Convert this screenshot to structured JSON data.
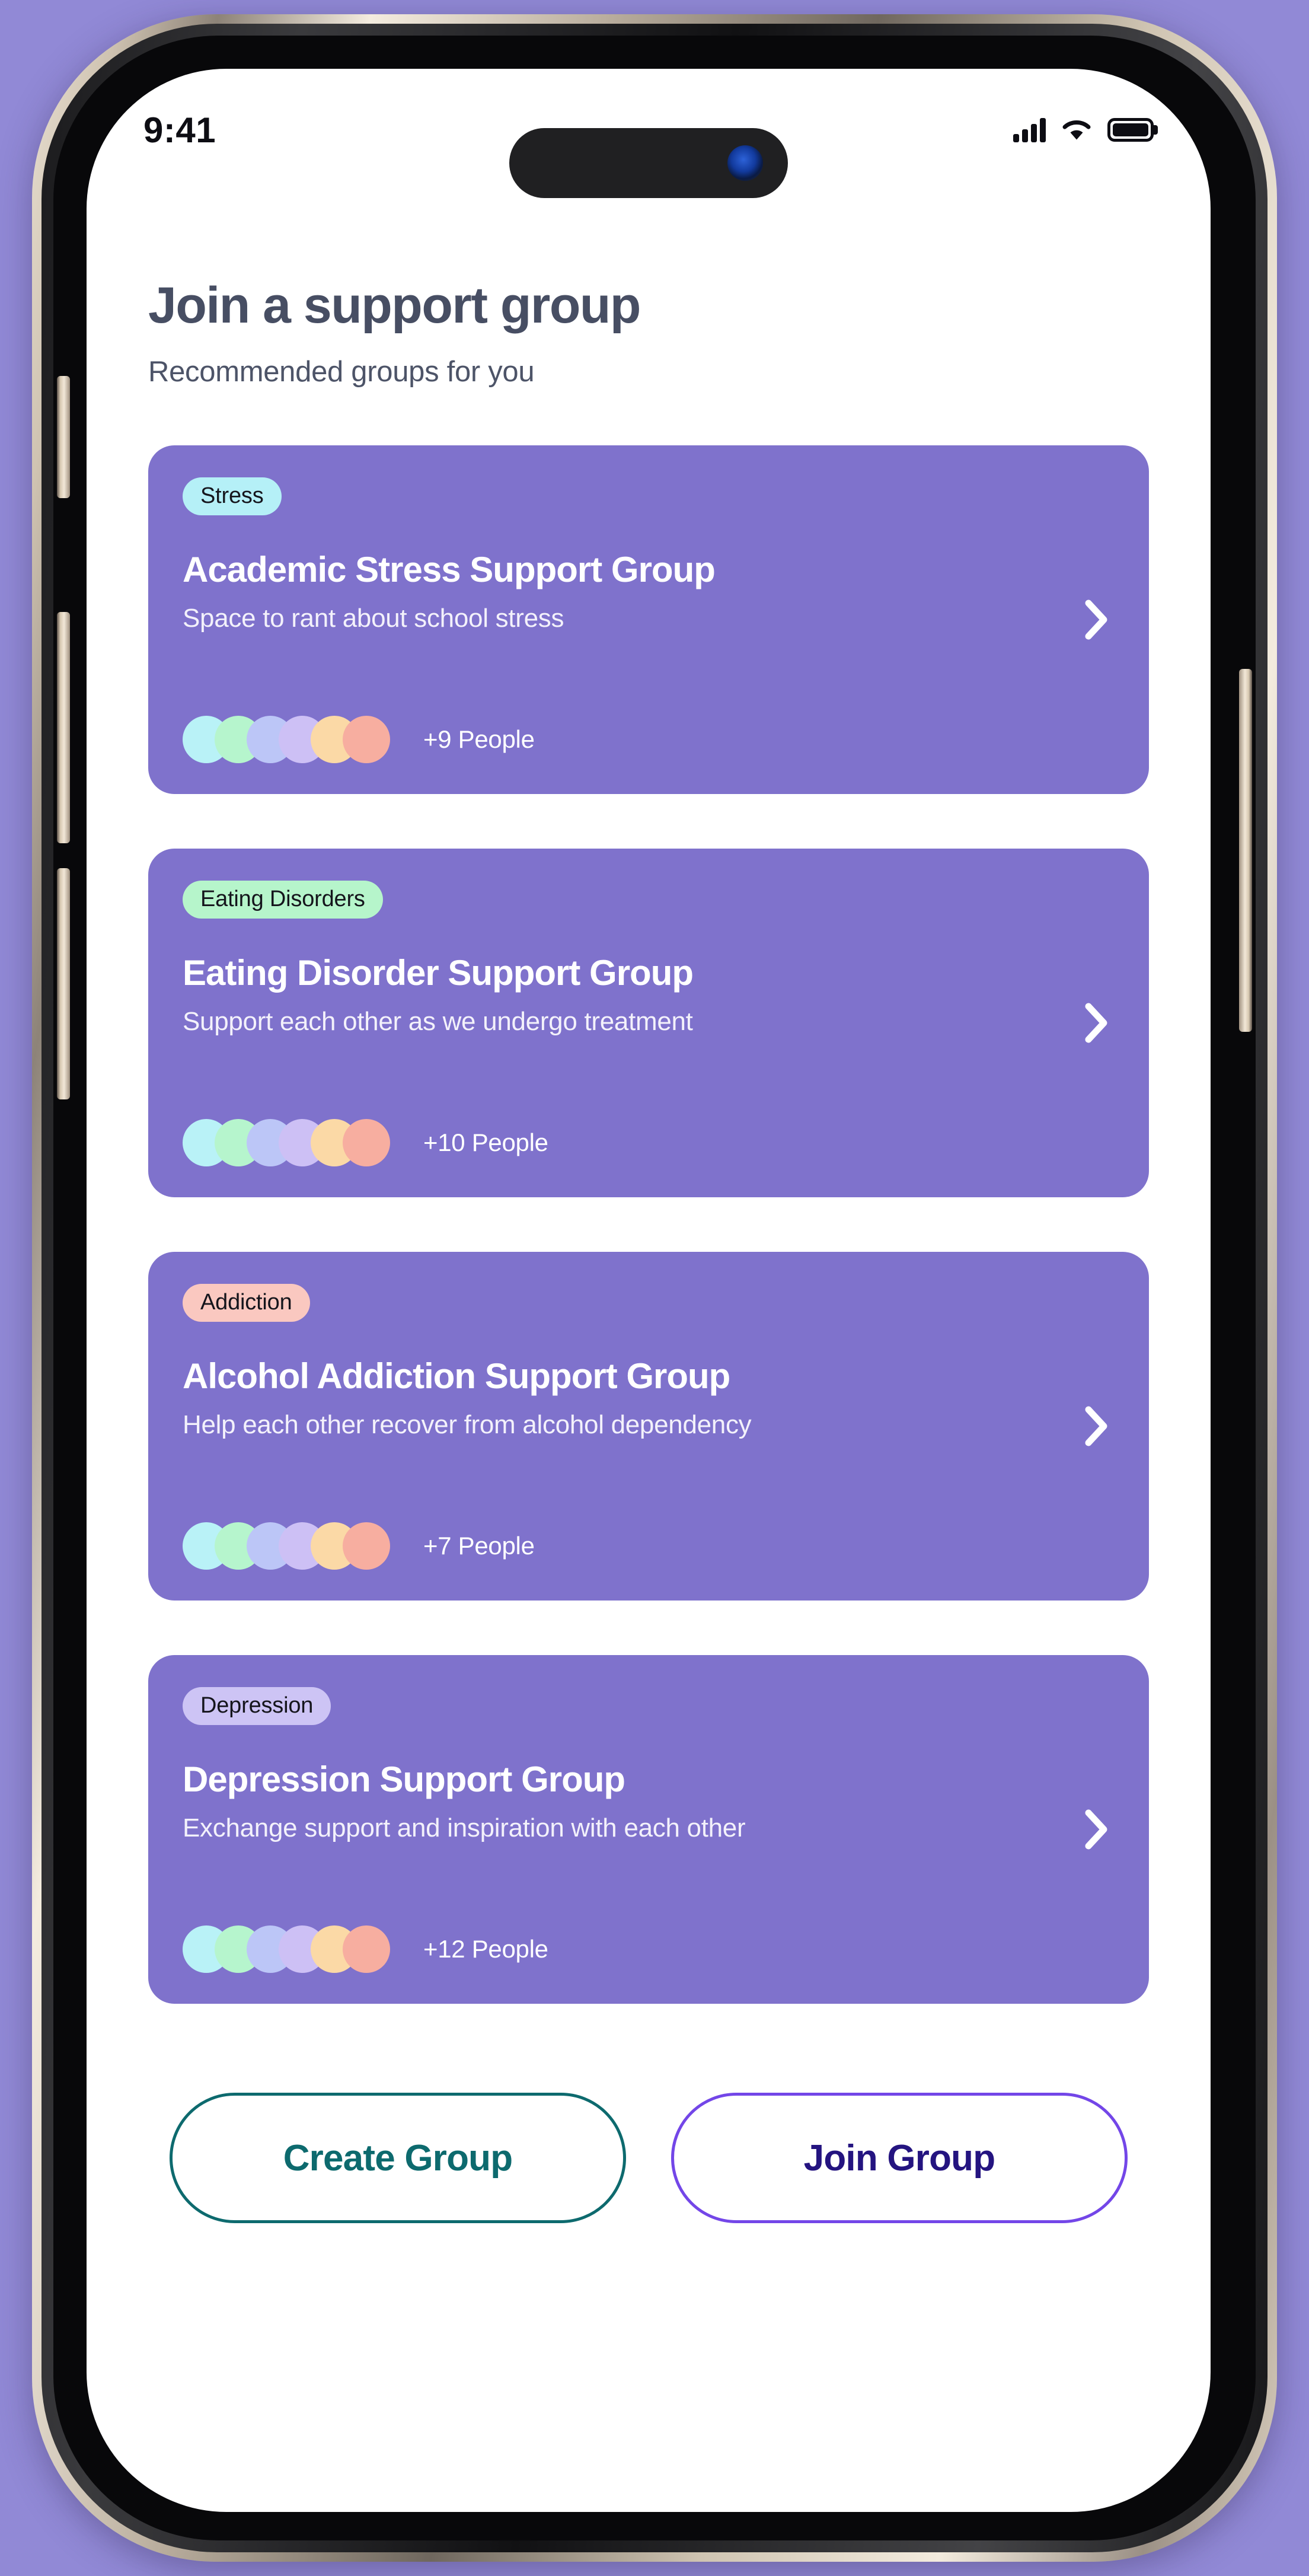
{
  "status_bar": {
    "time": "9:41",
    "cellular_icon": "cellular-bars-icon",
    "wifi_icon": "wifi-icon",
    "battery_icon": "battery-full-icon"
  },
  "header": {
    "title": "Join a support group",
    "subtitle": "Recommended groups for you"
  },
  "colors": {
    "page_background": "#9189d6",
    "screen_background": "#ffffff",
    "card_purple": "#7f72cc",
    "title_text": "#474e63",
    "create_group_accent": "#0d6a6e",
    "join_group_border": "#7346e8",
    "join_group_text": "#241480"
  },
  "avatar_colors": [
    "#b9f2f7",
    "#b6f5cd",
    "#bcc6f7",
    "#cdc0f5",
    "#fbd9a6",
    "#f7aea0"
  ],
  "groups": [
    {
      "badge": "Stress",
      "badge_color": "#b5f0f7",
      "title": "Academic Stress Support Group",
      "subtitle": "Space to rant about school stress",
      "people": "+9 People",
      "chevron_icon": "chevron-right-icon"
    },
    {
      "badge": "Eating Disorders",
      "badge_color": "#b6f5cb",
      "title": "Eating Disorder Support Group",
      "subtitle": "Support each other as we undergo treatment",
      "people": "+10 People",
      "chevron_icon": "chevron-right-icon"
    },
    {
      "badge": "Addiction",
      "badge_color": "#fac8c0",
      "title": "Alcohol Addiction Support Group",
      "subtitle": "Help each other recover from alcohol dependency",
      "people": "+7 People",
      "chevron_icon": "chevron-right-icon"
    },
    {
      "badge": "Depression",
      "badge_color": "#cdc4f5",
      "title": "Depression Support Group",
      "subtitle": "Exchange support and inspiration with each other",
      "people": "+12 People",
      "chevron_icon": "chevron-right-icon"
    }
  ],
  "footer": {
    "create_label": "Create Group",
    "join_label": "Join Group"
  },
  "device": {
    "buttons": [
      "action-button",
      "volume-up-button",
      "volume-down-button",
      "power-button"
    ],
    "dynamic_island": "dynamic-island"
  }
}
